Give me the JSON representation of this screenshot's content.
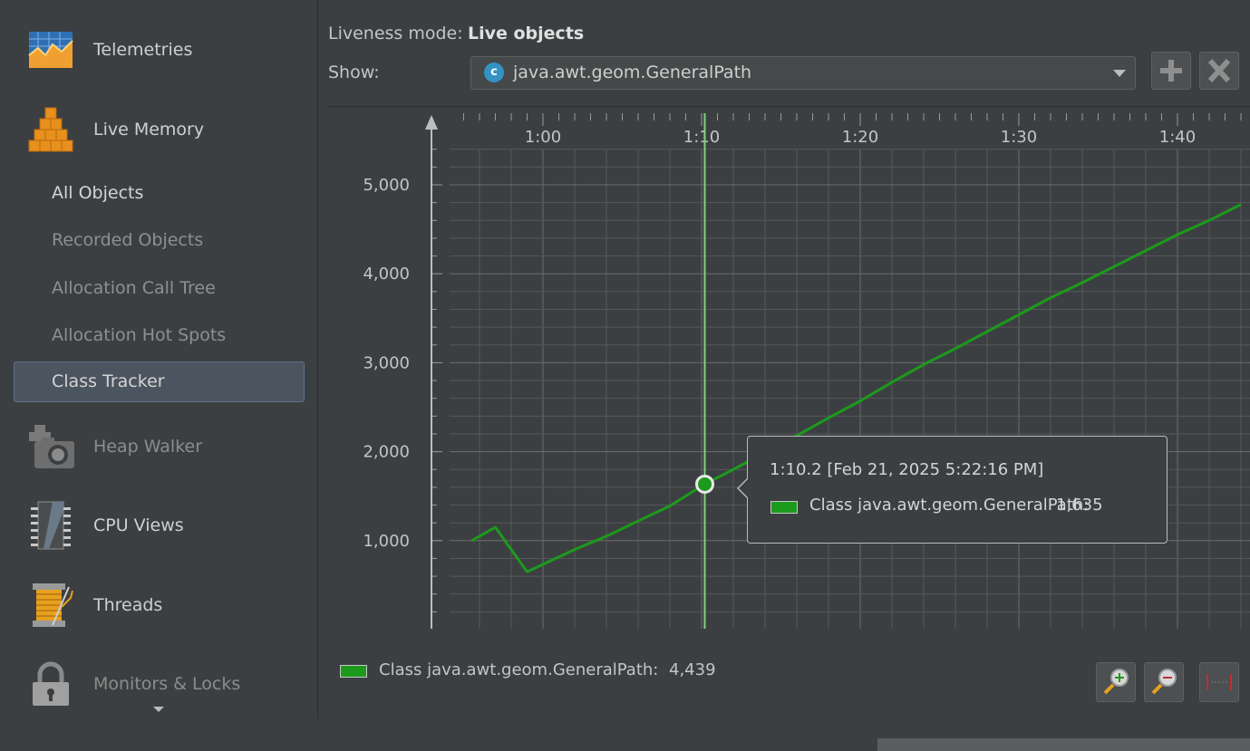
{
  "sidebar": {
    "items": [
      {
        "label": "Telemetries",
        "icon": "telemetries-icon"
      },
      {
        "label": "Live Memory",
        "icon": "live-memory-icon"
      },
      {
        "label": "Heap Walker",
        "icon": "heap-walker-icon"
      },
      {
        "label": "CPU Views",
        "icon": "cpu-views-icon"
      },
      {
        "label": "Threads",
        "icon": "threads-icon"
      },
      {
        "label": "Monitors & Locks",
        "icon": "monitors-locks-icon"
      }
    ],
    "live_memory_subitems": [
      {
        "label": "All Objects"
      },
      {
        "label": "Recorded Objects"
      },
      {
        "label": "Allocation Call Tree"
      },
      {
        "label": "Allocation Hot Spots"
      },
      {
        "label": "Class Tracker",
        "selected": true
      }
    ]
  },
  "header": {
    "liveness_label": "Liveness mode:",
    "liveness_value": "Live objects",
    "show_label": "Show:",
    "show_value": "java.awt.geom.GeneralPath",
    "show_icon_letter": "c"
  },
  "toolbar": {
    "add_icon": "plus-icon",
    "remove_icon": "close-icon"
  },
  "chart_data": {
    "type": "line",
    "x_tick_labels": [
      "1:00",
      "1:10",
      "1:20",
      "1:30",
      "1:40"
    ],
    "y_tick_labels": [
      "1,000",
      "2,000",
      "3,000",
      "4,000",
      "5,000"
    ],
    "x_unit": "seconds",
    "xlim": [
      55.0,
      104.0
    ],
    "ylim": [
      0,
      5500
    ],
    "grid": true,
    "series": [
      {
        "name": "Class java.awt.geom.GeneralPath",
        "color": "#1c9a1c",
        "x": [
          55.5,
          57.0,
          59.0,
          62.0,
          64.0,
          66.0,
          68.0,
          70.2,
          72.0,
          74.0,
          76.0,
          78.0,
          80.0,
          82.0,
          84.0,
          86.0,
          88.0,
          90.0,
          92.0,
          94.0,
          96.0,
          98.0,
          100.0,
          102.0,
          104.0
        ],
        "y": [
          1000,
          1150,
          650,
          900,
          1050,
          1220,
          1390,
          1635,
          1800,
          1990,
          2180,
          2380,
          2570,
          2780,
          2980,
          3160,
          3350,
          3540,
          3730,
          3900,
          4080,
          4260,
          4440,
          4600,
          4780
        ]
      }
    ],
    "cursor_x": 70.2
  },
  "tooltip": {
    "time": "1:10.2 [Feb 21, 2025 5:22:16 PM]",
    "series_label": "Class java.awt.geom.GeneralPath:",
    "value": "1,635"
  },
  "legend": {
    "label": "Class java.awt.geom.GeneralPath:",
    "value": "4,439"
  },
  "zoom": {
    "zoom_in_icon": "zoom-in-icon",
    "zoom_out_icon": "zoom-out-icon",
    "fit_icon": "fit-width-icon"
  }
}
